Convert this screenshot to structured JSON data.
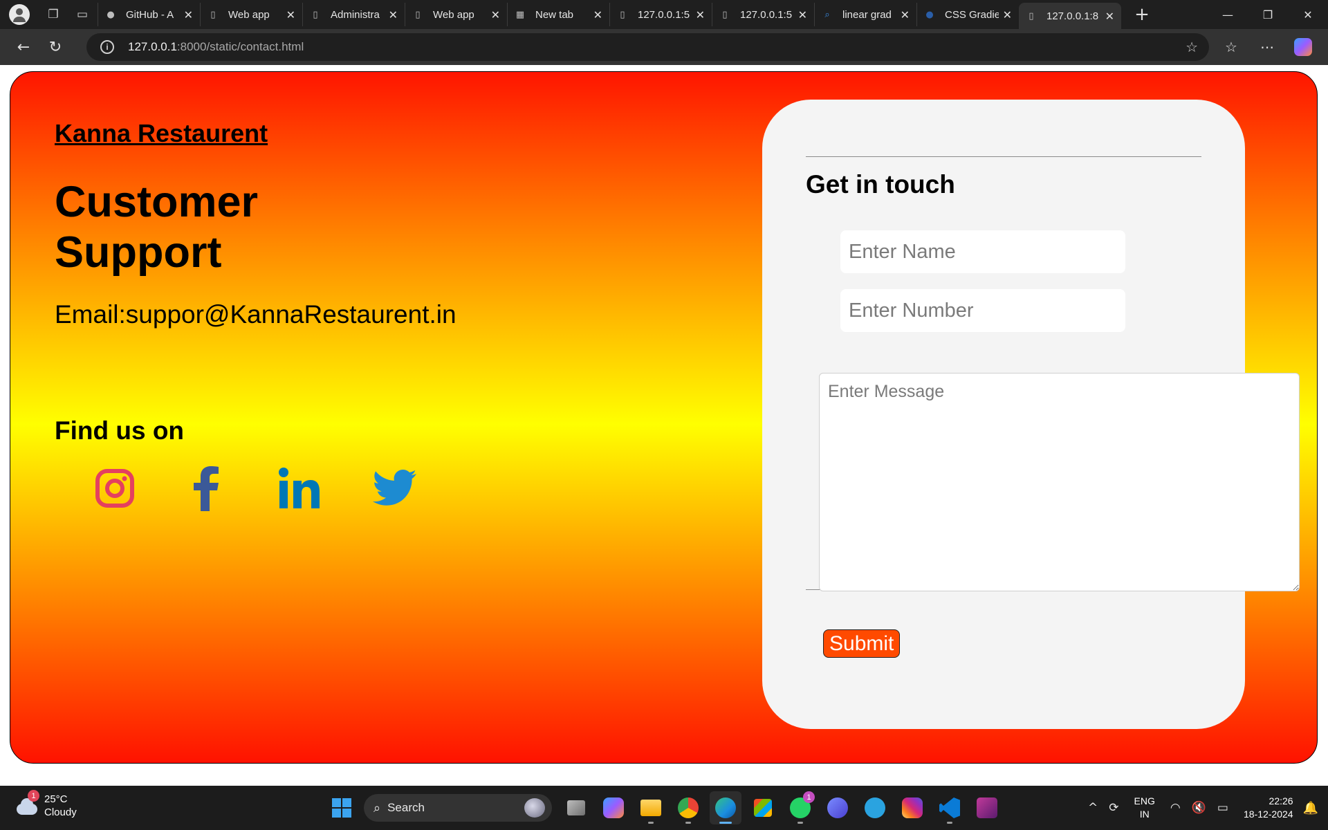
{
  "browser": {
    "tabs": [
      {
        "title": "GitHub - A",
        "icon": "github-icon"
      },
      {
        "title": "Web app",
        "icon": "page-icon"
      },
      {
        "title": "Administra",
        "icon": "page-icon"
      },
      {
        "title": "Web app",
        "icon": "page-icon"
      },
      {
        "title": "New tab",
        "icon": "newtab-icon"
      },
      {
        "title": "127.0.0.1:5",
        "icon": "page-icon"
      },
      {
        "title": "127.0.0.1:5",
        "icon": "page-icon"
      },
      {
        "title": "linear grad",
        "icon": "search-icon"
      },
      {
        "title": "CSS Gradie",
        "icon": "site-icon"
      },
      {
        "title": "127.0.0.1:8",
        "icon": "page-icon",
        "active": true
      }
    ],
    "url_host": "127.0.0.1",
    "url_path": ":8000/static/contact.html"
  },
  "page": {
    "brand": "Kanna Restaurent",
    "title": "Customer Support",
    "email": "Email:suppor@KannaRestaurent.in",
    "find_us": "Find us on",
    "socials": [
      {
        "name": "instagram",
        "color": "#e4405f"
      },
      {
        "name": "facebook",
        "color": "#3b5998"
      },
      {
        "name": "linkedin",
        "color": "#0077b5"
      },
      {
        "name": "twitter",
        "color": "#1da1f2"
      }
    ],
    "gradient": [
      "#ff1500",
      "#ff8a00",
      "#ffff00",
      "#ff8a00",
      "#ff1200"
    ]
  },
  "form": {
    "heading": "Get in touch",
    "name_placeholder": "Enter Name",
    "number_placeholder": "Enter Number",
    "message_placeholder": "Enter Message",
    "submit_label": "Submit",
    "submit_color": "#ff4a00"
  },
  "taskbar": {
    "weather_temp": "25°C",
    "weather_desc": "Cloudy",
    "weather_badge": "1",
    "search_label": "Search",
    "whatsapp_badge": "1",
    "lang_top": "ENG",
    "lang_bottom": "IN",
    "time": "22:26",
    "date": "18-12-2024"
  }
}
